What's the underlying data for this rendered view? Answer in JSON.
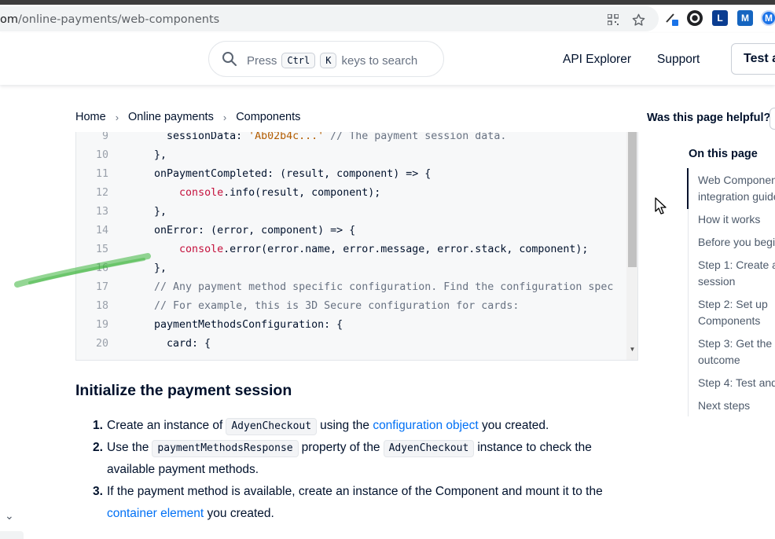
{
  "browser": {
    "url_host": "om",
    "url_path": "/online-payments/web-components",
    "icons": [
      "qr-code-icon",
      "star-icon",
      "eyedropper-extension-icon",
      "circle-extension-icon",
      "l-extension-icon",
      "m-extension-icon",
      "m-round-extension-icon"
    ],
    "ext_labels": {
      "l": "L",
      "m": "M",
      "m2": "M"
    }
  },
  "header": {
    "search": {
      "press": "Press",
      "key1": "Ctrl",
      "key2": "K",
      "suffix": "keys to search"
    },
    "nav": {
      "api_explorer": "API Explorer",
      "support": "Support",
      "test": "Test a"
    }
  },
  "breadcrumb": [
    "Home",
    "Online payments",
    "Components"
  ],
  "code": {
    "lines": [
      {
        "n": "9",
        "parts": [
          {
            "t": "    sessionData: ",
            "c": ""
          },
          {
            "t": "'Ab02b4c...'",
            "c": "str"
          },
          {
            "t": " // The payment session data.",
            "c": "com"
          }
        ]
      },
      {
        "n": "10",
        "parts": [
          {
            "t": "  },",
            "c": ""
          }
        ]
      },
      {
        "n": "11",
        "parts": [
          {
            "t": "  onPaymentCompleted: (result, component) => {",
            "c": ""
          }
        ]
      },
      {
        "n": "12",
        "parts": [
          {
            "t": "      ",
            "c": ""
          },
          {
            "t": "console",
            "c": "red"
          },
          {
            "t": ".info(result, component);",
            "c": ""
          }
        ]
      },
      {
        "n": "13",
        "parts": [
          {
            "t": "  },",
            "c": ""
          }
        ]
      },
      {
        "n": "14",
        "parts": [
          {
            "t": "  onError: (error, component) => {",
            "c": ""
          }
        ]
      },
      {
        "n": "15",
        "parts": [
          {
            "t": "      ",
            "c": ""
          },
          {
            "t": "console",
            "c": "red"
          },
          {
            "t": ".error(error.name, error.message, error.stack, component);",
            "c": ""
          }
        ]
      },
      {
        "n": "16",
        "parts": [
          {
            "t": "  },",
            "c": ""
          }
        ]
      },
      {
        "n": "17",
        "parts": [
          {
            "t": "  // Any payment method specific configuration. Find the configuration spec",
            "c": "com"
          }
        ]
      },
      {
        "n": "18",
        "parts": [
          {
            "t": "  // For example, this is 3D Secure configuration for cards:",
            "c": "com"
          }
        ]
      },
      {
        "n": "19",
        "parts": [
          {
            "t": "  paymentMethodsConfiguration: {",
            "c": ""
          }
        ]
      },
      {
        "n": "20",
        "parts": [
          {
            "t": "    card: {",
            "c": ""
          }
        ]
      }
    ]
  },
  "content": {
    "section_title": "Initialize the payment session",
    "steps": [
      {
        "num": "1.",
        "parts": [
          {
            "t": "Create an instance of",
            "k": "text"
          },
          {
            "t": "AdyenCheckout",
            "k": "code"
          },
          {
            "t": "using the ",
            "k": "text"
          },
          {
            "t": "configuration object",
            "k": "link"
          },
          {
            "t": " you created.",
            "k": "text"
          }
        ]
      },
      {
        "num": "2.",
        "parts": [
          {
            "t": "Use the",
            "k": "text"
          },
          {
            "t": "paymentMethodsResponse",
            "k": "code"
          },
          {
            "t": "property of the",
            "k": "text"
          },
          {
            "t": "AdyenCheckout",
            "k": "code"
          },
          {
            "t": "instance to check the available payment methods.",
            "k": "text"
          }
        ]
      },
      {
        "num": "3.",
        "parts": [
          {
            "t": "If the payment method is available, create an instance of the Component and mount it to the ",
            "k": "text"
          },
          {
            "t": "container element",
            "k": "link"
          },
          {
            "t": " you created.",
            "k": "text"
          }
        ]
      }
    ]
  },
  "sidebar": {
    "helpful": "Was this page helpful?",
    "toc_title": "On this page",
    "toc": [
      "Web Componen integration guide",
      "How it works",
      "Before you begin",
      "Step 1: Create a session",
      "Step 2: Set up Components",
      "Step 3: Get the p outcome",
      "Step 4: Test and",
      "Next steps"
    ]
  },
  "colors": {
    "text": "#00112c",
    "link": "#0070f5",
    "code_bg": "#f7f8f9",
    "highlighter": "#3cb43c"
  }
}
